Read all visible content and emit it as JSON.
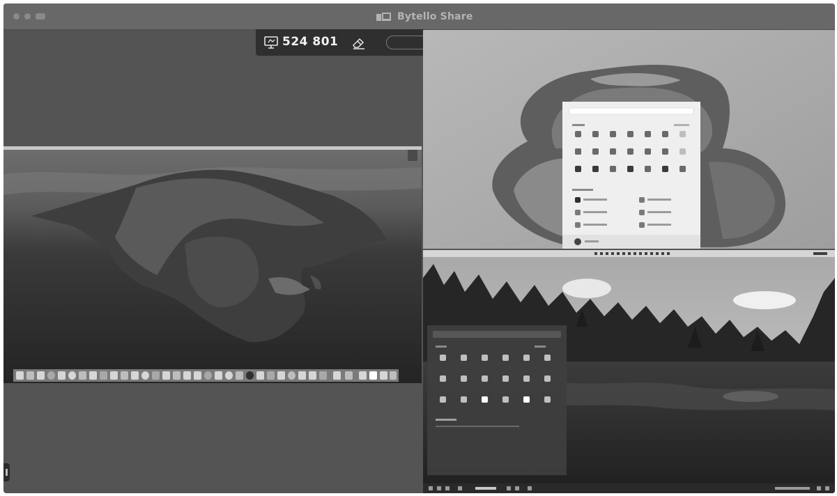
{
  "window": {
    "title": "Bytello Share",
    "title_icon": "screen-share-icon",
    "controls": [
      "close",
      "minimize",
      "zoom"
    ]
  },
  "session": {
    "code": "524 801",
    "code_icon": "monitor-icon",
    "annotate_icon": "eraser-icon"
  },
  "screens": [
    {
      "id": "macos",
      "desktop": "macOS Catalina",
      "dock_icon": "dock-icon"
    },
    {
      "id": "windows",
      "desktop": "Windows 11",
      "start_menu_icon": "start-menu-icon"
    },
    {
      "id": "linux",
      "desktop": "Linux",
      "launcher_icon": "app-launcher-icon"
    }
  ],
  "colors": {
    "window_bg": "#545454",
    "titlebar": "#686868",
    "code_bar": "#2f2f2f"
  }
}
